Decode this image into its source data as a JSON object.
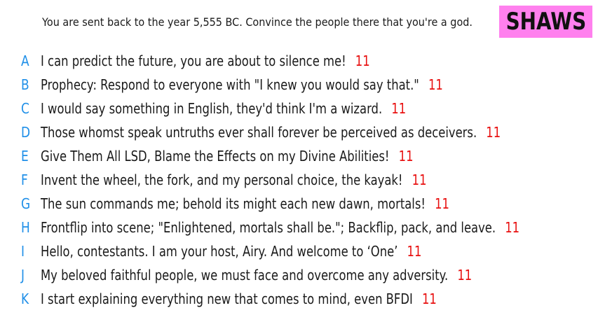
{
  "prompt": "You are sent back to the year 5,555 BC. Convince the people there that you're a god.",
  "logo": "SHAWS",
  "colors": {
    "letter": "#1f8fe8",
    "score": "#e81010",
    "logo_bg": "#ff80ee"
  },
  "answers": [
    {
      "letter": "A",
      "text": "I can predict the future, you are about to silence me!",
      "score": "11"
    },
    {
      "letter": "B",
      "text": "Prophecy: Respond to everyone with \"I knew you would say that.\"",
      "score": "11"
    },
    {
      "letter": "C",
      "text": "I would say something in English, they'd think I'm a wizard.",
      "score": "11"
    },
    {
      "letter": "D",
      "text": "Those whomst speak untruths ever shall forever be perceived as deceivers.",
      "score": "11"
    },
    {
      "letter": "E",
      "text": "Give Them All LSD, Blame the Effects on my Divine Abilities!",
      "score": "11"
    },
    {
      "letter": "F",
      "text": "Invent the wheel, the fork, and my personal choice, the kayak!",
      "score": "11"
    },
    {
      "letter": "G",
      "text": "The sun commands me; behold its might each new dawn, mortals!",
      "score": "11"
    },
    {
      "letter": "H",
      "text": "Frontflip into scene; \"Enlightened, mortals shall be.\"; Backflip, pack, and leave.",
      "score": "11"
    },
    {
      "letter": "I",
      "text": "Hello, contestants. I am your host, Airy. And welcome to ‘One’",
      "score": "11"
    },
    {
      "letter": "J",
      "text": "My beloved faithful people, we must face and overcome any adversity.",
      "score": "11"
    },
    {
      "letter": "K",
      "text": "I start explaining everything new that comes to mind, even BFDI",
      "score": "11"
    }
  ]
}
